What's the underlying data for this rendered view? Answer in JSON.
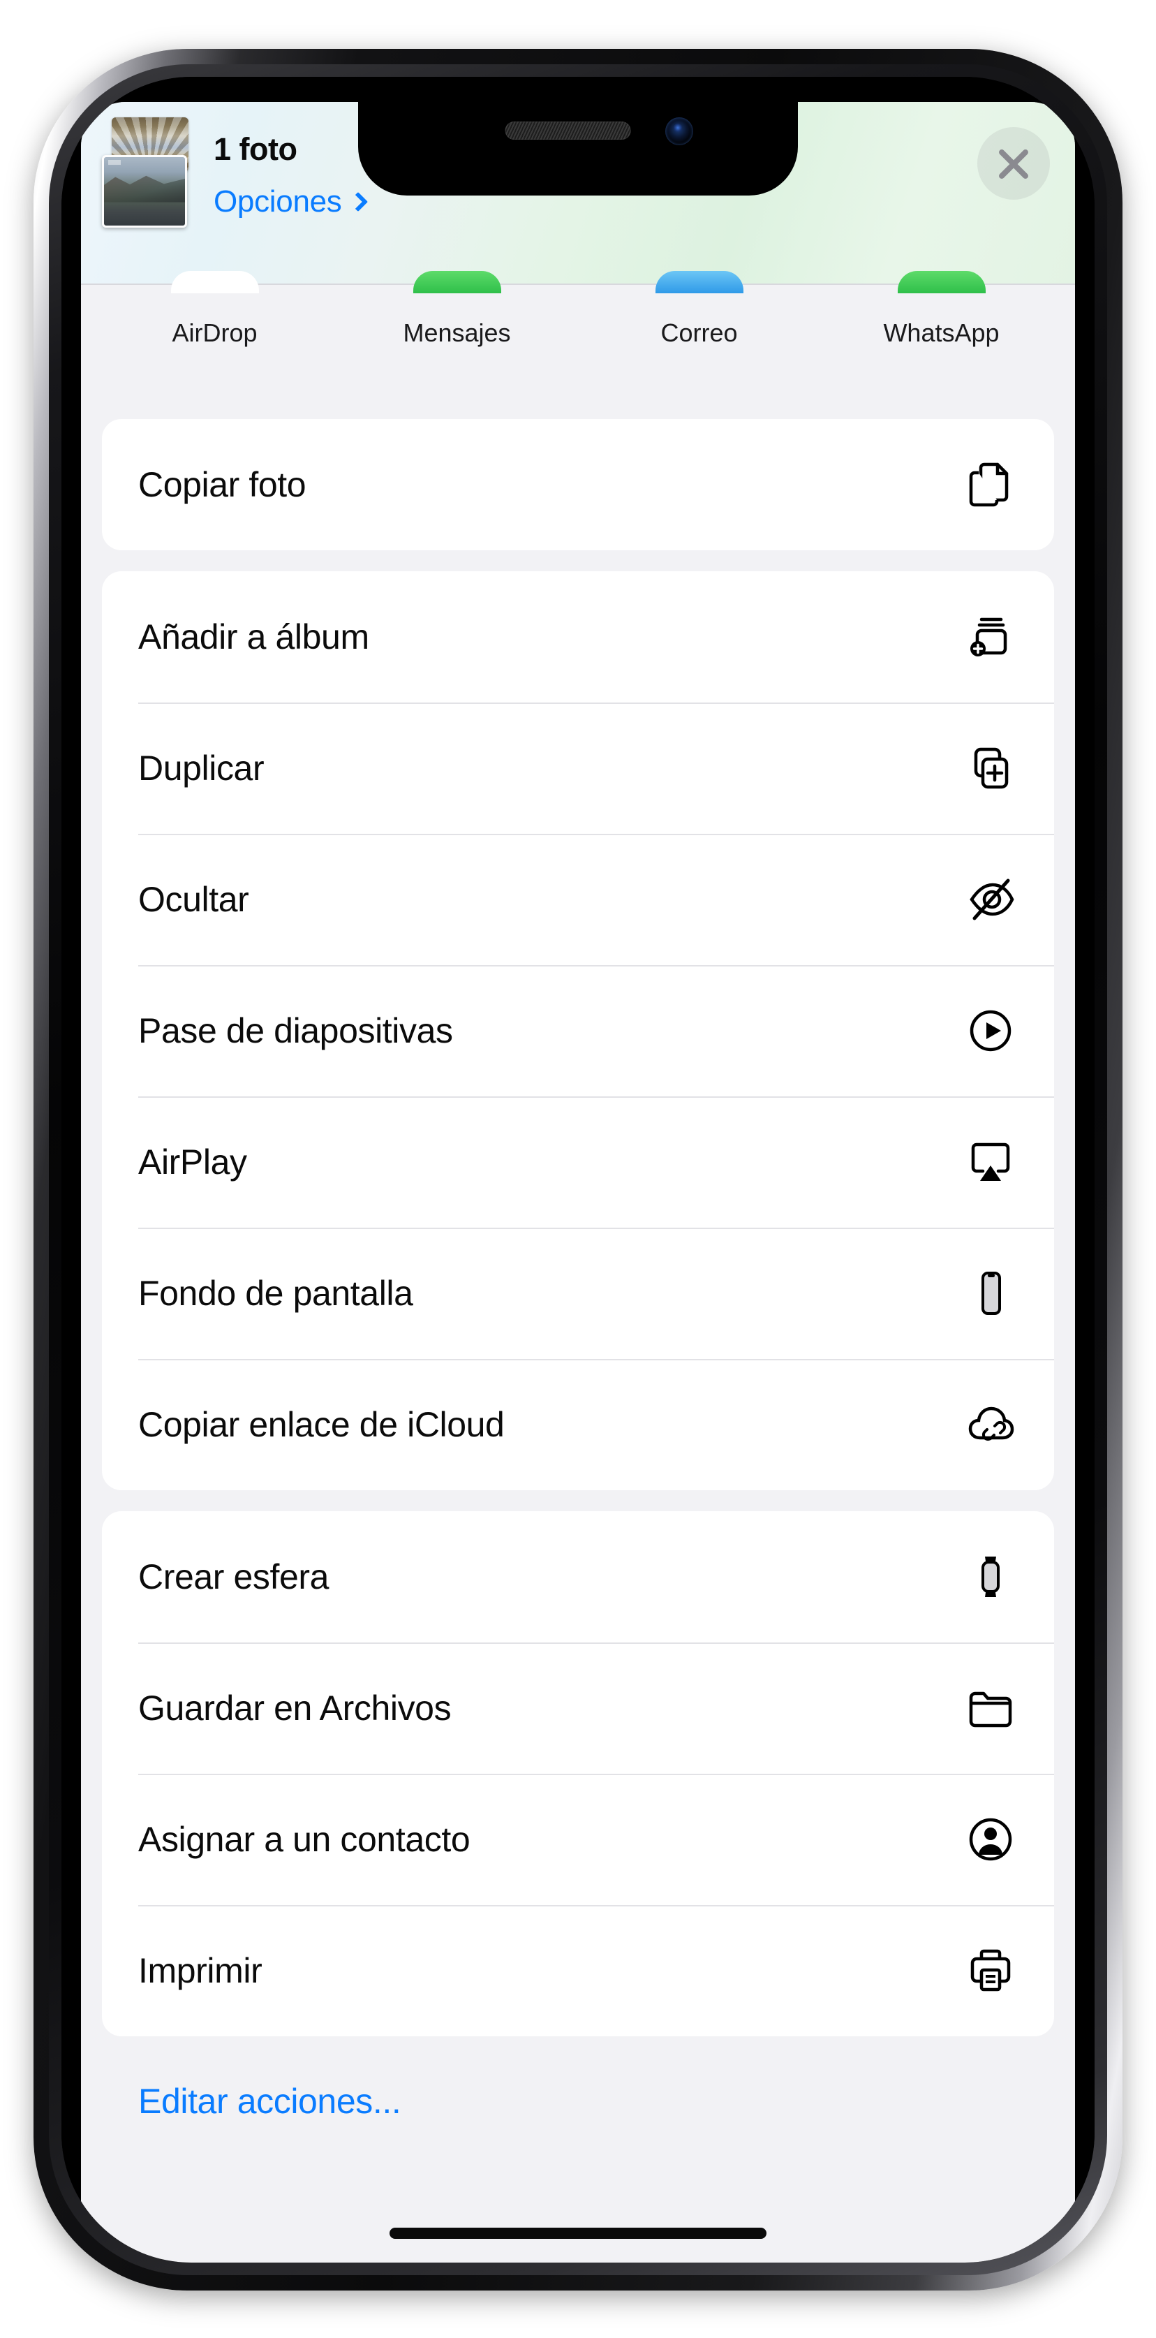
{
  "sheet": {
    "title": "1 foto",
    "options_label": "Opciones",
    "options_chevron": "chevron-right-icon",
    "close_label": "close-icon",
    "thumbnail": "photo-thumbnail-stack"
  },
  "app_row": {
    "apps": [
      {
        "label": "AirDrop",
        "color": "#ffffff"
      },
      {
        "label": "Mensajes",
        "color": "#4bd25f"
      },
      {
        "label": "Correo",
        "color": "#4aa8f0"
      },
      {
        "label": "WhatsApp",
        "color": "#4bd25f"
      }
    ]
  },
  "groups": [
    {
      "rows": [
        {
          "label": "Copiar foto",
          "icon": "copy-doc-on-doc-icon"
        }
      ]
    },
    {
      "rows": [
        {
          "label": "Añadir a álbum",
          "icon": "rectangle-stack-badge-plus-icon"
        },
        {
          "label": "Duplicar",
          "icon": "plus-square-on-square-icon"
        },
        {
          "label": "Ocultar",
          "icon": "eye-slash-icon"
        },
        {
          "label": "Pase de diapositivas",
          "icon": "play-circle-icon"
        },
        {
          "label": "AirPlay",
          "icon": "airplayvideo-icon"
        },
        {
          "label": "Fondo de pantalla",
          "icon": "iphone-wallpaper-icon"
        },
        {
          "label": "Copiar enlace de iCloud",
          "icon": "link-cloud-icon"
        }
      ]
    },
    {
      "rows": [
        {
          "label": "Crear esfera",
          "icon": "applewatch-icon"
        },
        {
          "label": "Guardar en Archivos",
          "icon": "folder-icon"
        },
        {
          "label": "Asignar a un contacto",
          "icon": "person-circle-icon"
        },
        {
          "label": "Imprimir",
          "icon": "printer-icon"
        }
      ]
    }
  ],
  "footer": {
    "edit_actions_label": "Editar acciones..."
  },
  "colors": {
    "accent_blue": "#0a7cff",
    "sheet_background": "#f2f2f5",
    "row_background": "#ffffff",
    "separator": "#e2e2e6",
    "label_text": "#0b0b0b",
    "close_glyph": "#8a8a90"
  }
}
